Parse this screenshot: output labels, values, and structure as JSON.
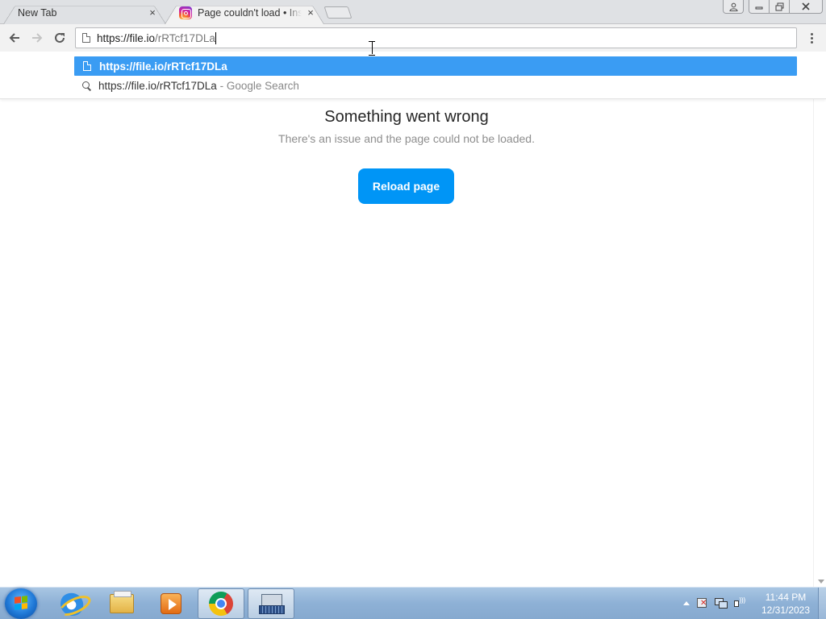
{
  "tabs": [
    {
      "title": "New Tab",
      "close": "×",
      "active": false
    },
    {
      "title": "Page couldn't load • Instagram",
      "close": "×",
      "active": true,
      "favicon": "instagram-icon"
    }
  ],
  "window_controls": {
    "profile": "person-icon",
    "minimize": "minimize-icon",
    "maximize": "restore-icon",
    "close": "close-icon"
  },
  "toolbar": {
    "back": "back-arrow-icon",
    "forward": "forward-arrow-icon",
    "reload": "reload-icon",
    "url_host": "https://file.io",
    "url_path": "/rRTcf17DLa",
    "menu": "more-vert-icon"
  },
  "omnibox_dropdown": {
    "suggestions": [
      {
        "text": "https://file.io/rRTcf17DLa",
        "icon": "page-icon",
        "selected": true
      },
      {
        "text": "https://file.io/rRTcf17DLa",
        "suffix": "- Google Search",
        "icon": "search-icon",
        "selected": false
      }
    ]
  },
  "page": {
    "title": "Something went wrong",
    "subtitle": "There's an issue and the page could not be loaded.",
    "button_label": "Reload page",
    "button_color": "#0095f6"
  },
  "taskbar": {
    "apps": [
      "internet-explorer-icon",
      "windows-explorer-icon",
      "media-player-icon",
      "chrome-icon",
      "on-screen-keyboard-icon"
    ],
    "clock_time": "11:44 PM",
    "clock_date": "12/31/2023"
  },
  "colors": {
    "accent": "#3a9cf3",
    "tabstrip": "#dfe1e4",
    "taskbar": "#8eb1d6"
  }
}
